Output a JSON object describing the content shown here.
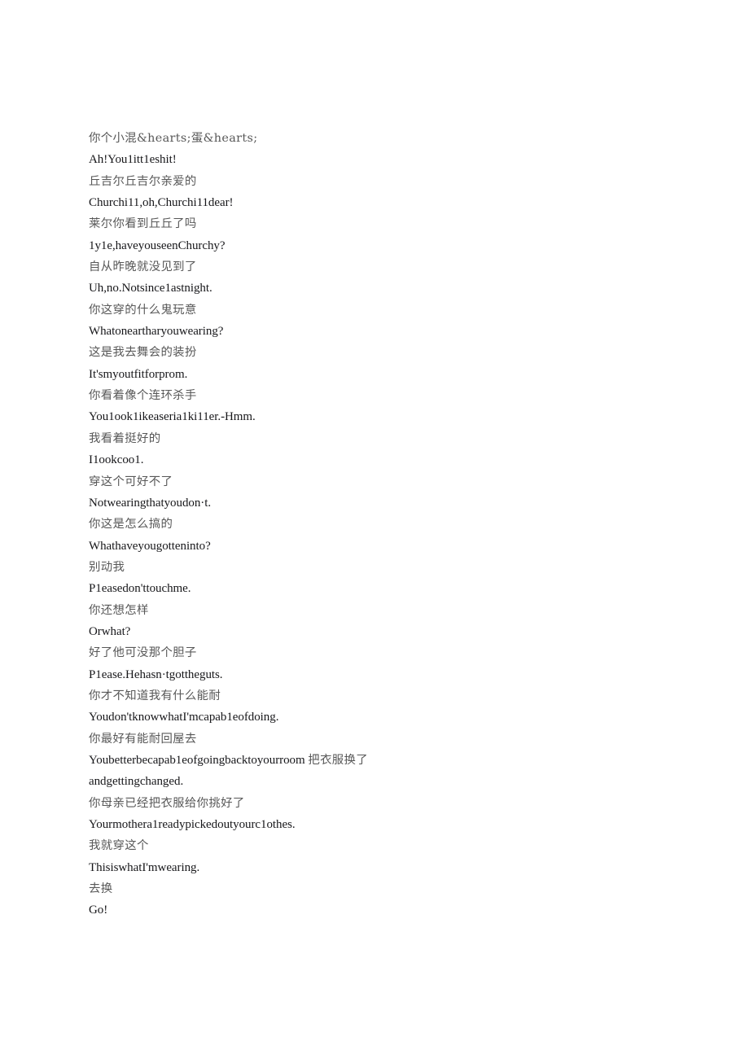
{
  "document": {
    "background_color": "#ffffff",
    "zh_color": "#585858",
    "en_color": "#17171a"
  },
  "transcript": {
    "lines": [
      {
        "lang": "zh",
        "text": "你个小混&hearts;蛋&hearts;"
      },
      {
        "lang": "en",
        "text": "Ah!You1itt1eshit!"
      },
      {
        "lang": "zh",
        "text": "丘吉尔丘吉尔亲爱的"
      },
      {
        "lang": "en",
        "text": "Churchi11,oh,Churchi11dear!"
      },
      {
        "lang": "zh",
        "text": "莱尔你看到丘丘了吗"
      },
      {
        "lang": "en",
        "text": "1y1e,haveyouseenChurchy?"
      },
      {
        "lang": "zh",
        "text": "自从昨晚就没见到了"
      },
      {
        "lang": "en",
        "text": "Uh,no.Notsince1astnight."
      },
      {
        "lang": "zh",
        "text": "你这穿的什么鬼玩意"
      },
      {
        "lang": "en",
        "text": "Whatoneartharyouwearing?"
      },
      {
        "lang": "zh",
        "text": "这是我去舞会的装扮"
      },
      {
        "lang": "en",
        "text": "It'smyoutfitforprom."
      },
      {
        "lang": "zh",
        "text": "你看着像个连环杀手"
      },
      {
        "lang": "en",
        "text": "You1ook1ikeaseria1ki11er.-Hmm."
      },
      {
        "lang": "zh",
        "text": "我看着挺好的"
      },
      {
        "lang": "en",
        "text": "I1ookcoo1."
      },
      {
        "lang": "zh",
        "text": "穿这个可好不了"
      },
      {
        "lang": "en",
        "text": "Notwearingthatyoudon·t."
      },
      {
        "lang": "zh",
        "text": "你这是怎么搞的"
      },
      {
        "lang": "en",
        "text": "Whathaveyougotteninto?"
      },
      {
        "lang": "zh",
        "text": "别动我"
      },
      {
        "lang": "en",
        "text": "P1easedon'ttouchme."
      },
      {
        "lang": "zh",
        "text": "你还想怎样"
      },
      {
        "lang": "en",
        "text": "Orwhat?"
      },
      {
        "lang": "zh",
        "text": "好了他可没那个胆子"
      },
      {
        "lang": "en",
        "text": "P1ease.Hehasn·tgottheguts."
      },
      {
        "lang": "zh",
        "text": "你才不知道我有什么能耐"
      },
      {
        "lang": "en",
        "text": "Youdon'tknowwhatI'mcapab1eofdoing."
      },
      {
        "lang": "zh",
        "text": "你最好有能耐回屋去"
      },
      {
        "lang": "en-mixed",
        "text_en_start": "Youbetterbecapab1eofgoingbacktoyourroom ",
        "text_zh_inline": "把衣服换了",
        "text_en_end": "andgettingchanged."
      },
      {
        "lang": "zh",
        "text": "你母亲已经把衣服给你挑好了"
      },
      {
        "lang": "en",
        "text": "Yourmothera1readypickedoutyourc1othes."
      },
      {
        "lang": "zh",
        "text": "我就穿这个"
      },
      {
        "lang": "en",
        "text": "ThisiswhatI'mwearing."
      },
      {
        "lang": "zh",
        "text": "去换"
      },
      {
        "lang": "en",
        "text": "Go!"
      }
    ]
  }
}
